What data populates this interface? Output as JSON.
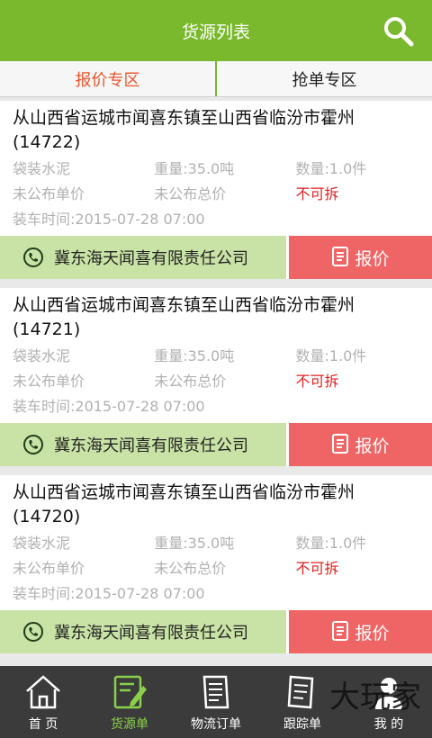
{
  "header": {
    "title": "货源列表"
  },
  "tabs": [
    {
      "label": "报价专区",
      "active": true
    },
    {
      "label": "抢单专区",
      "active": false
    }
  ],
  "cards": [
    {
      "route": "从山西省运城市闻喜东镇至山西省临汾市霍州(14722)",
      "cargo": "袋装水泥",
      "weight": "重量:35.0吨",
      "quantity": "数量:1.0件",
      "unit_price": "未公布单价",
      "total_price": "未公布总价",
      "split": "不可拆",
      "load_time": "装车时间:2015-07-28 07:00",
      "company": "冀东海天闻喜有限责任公司",
      "quote_label": "报价"
    },
    {
      "route": "从山西省运城市闻喜东镇至山西省临汾市霍州(14721)",
      "cargo": "袋装水泥",
      "weight": "重量:35.0吨",
      "quantity": "数量:1.0件",
      "unit_price": "未公布单价",
      "total_price": "未公布总价",
      "split": "不可拆",
      "load_time": "装车时间:2015-07-28 07:00",
      "company": "冀东海天闻喜有限责任公司",
      "quote_label": "报价"
    },
    {
      "route": "从山西省运城市闻喜东镇至山西省临汾市霍州(14720)",
      "cargo": "袋装水泥",
      "weight": "重量:35.0吨",
      "quantity": "数量:1.0件",
      "unit_price": "未公布单价",
      "total_price": "未公布总价",
      "split": "不可拆",
      "load_time": "装车时间:2015-07-28 07:00",
      "company": "冀东海天闻喜有限责任公司",
      "quote_label": "报价"
    }
  ],
  "bottom_nav": [
    {
      "label": "首 页",
      "icon": "home-icon",
      "active": false
    },
    {
      "label": "货源单",
      "icon": "cargo-list-icon",
      "active": true
    },
    {
      "label": "物流订单",
      "icon": "order-icon",
      "active": false
    },
    {
      "label": "跟踪单",
      "icon": "track-icon",
      "active": false
    },
    {
      "label": "我 的",
      "icon": "user-icon",
      "active": false
    }
  ],
  "watermark": "大玩家",
  "colors": {
    "accent": "#7ab92e",
    "quote": "#ef6566",
    "company_bg": "#c9e2a5",
    "alert": "#e02020"
  }
}
